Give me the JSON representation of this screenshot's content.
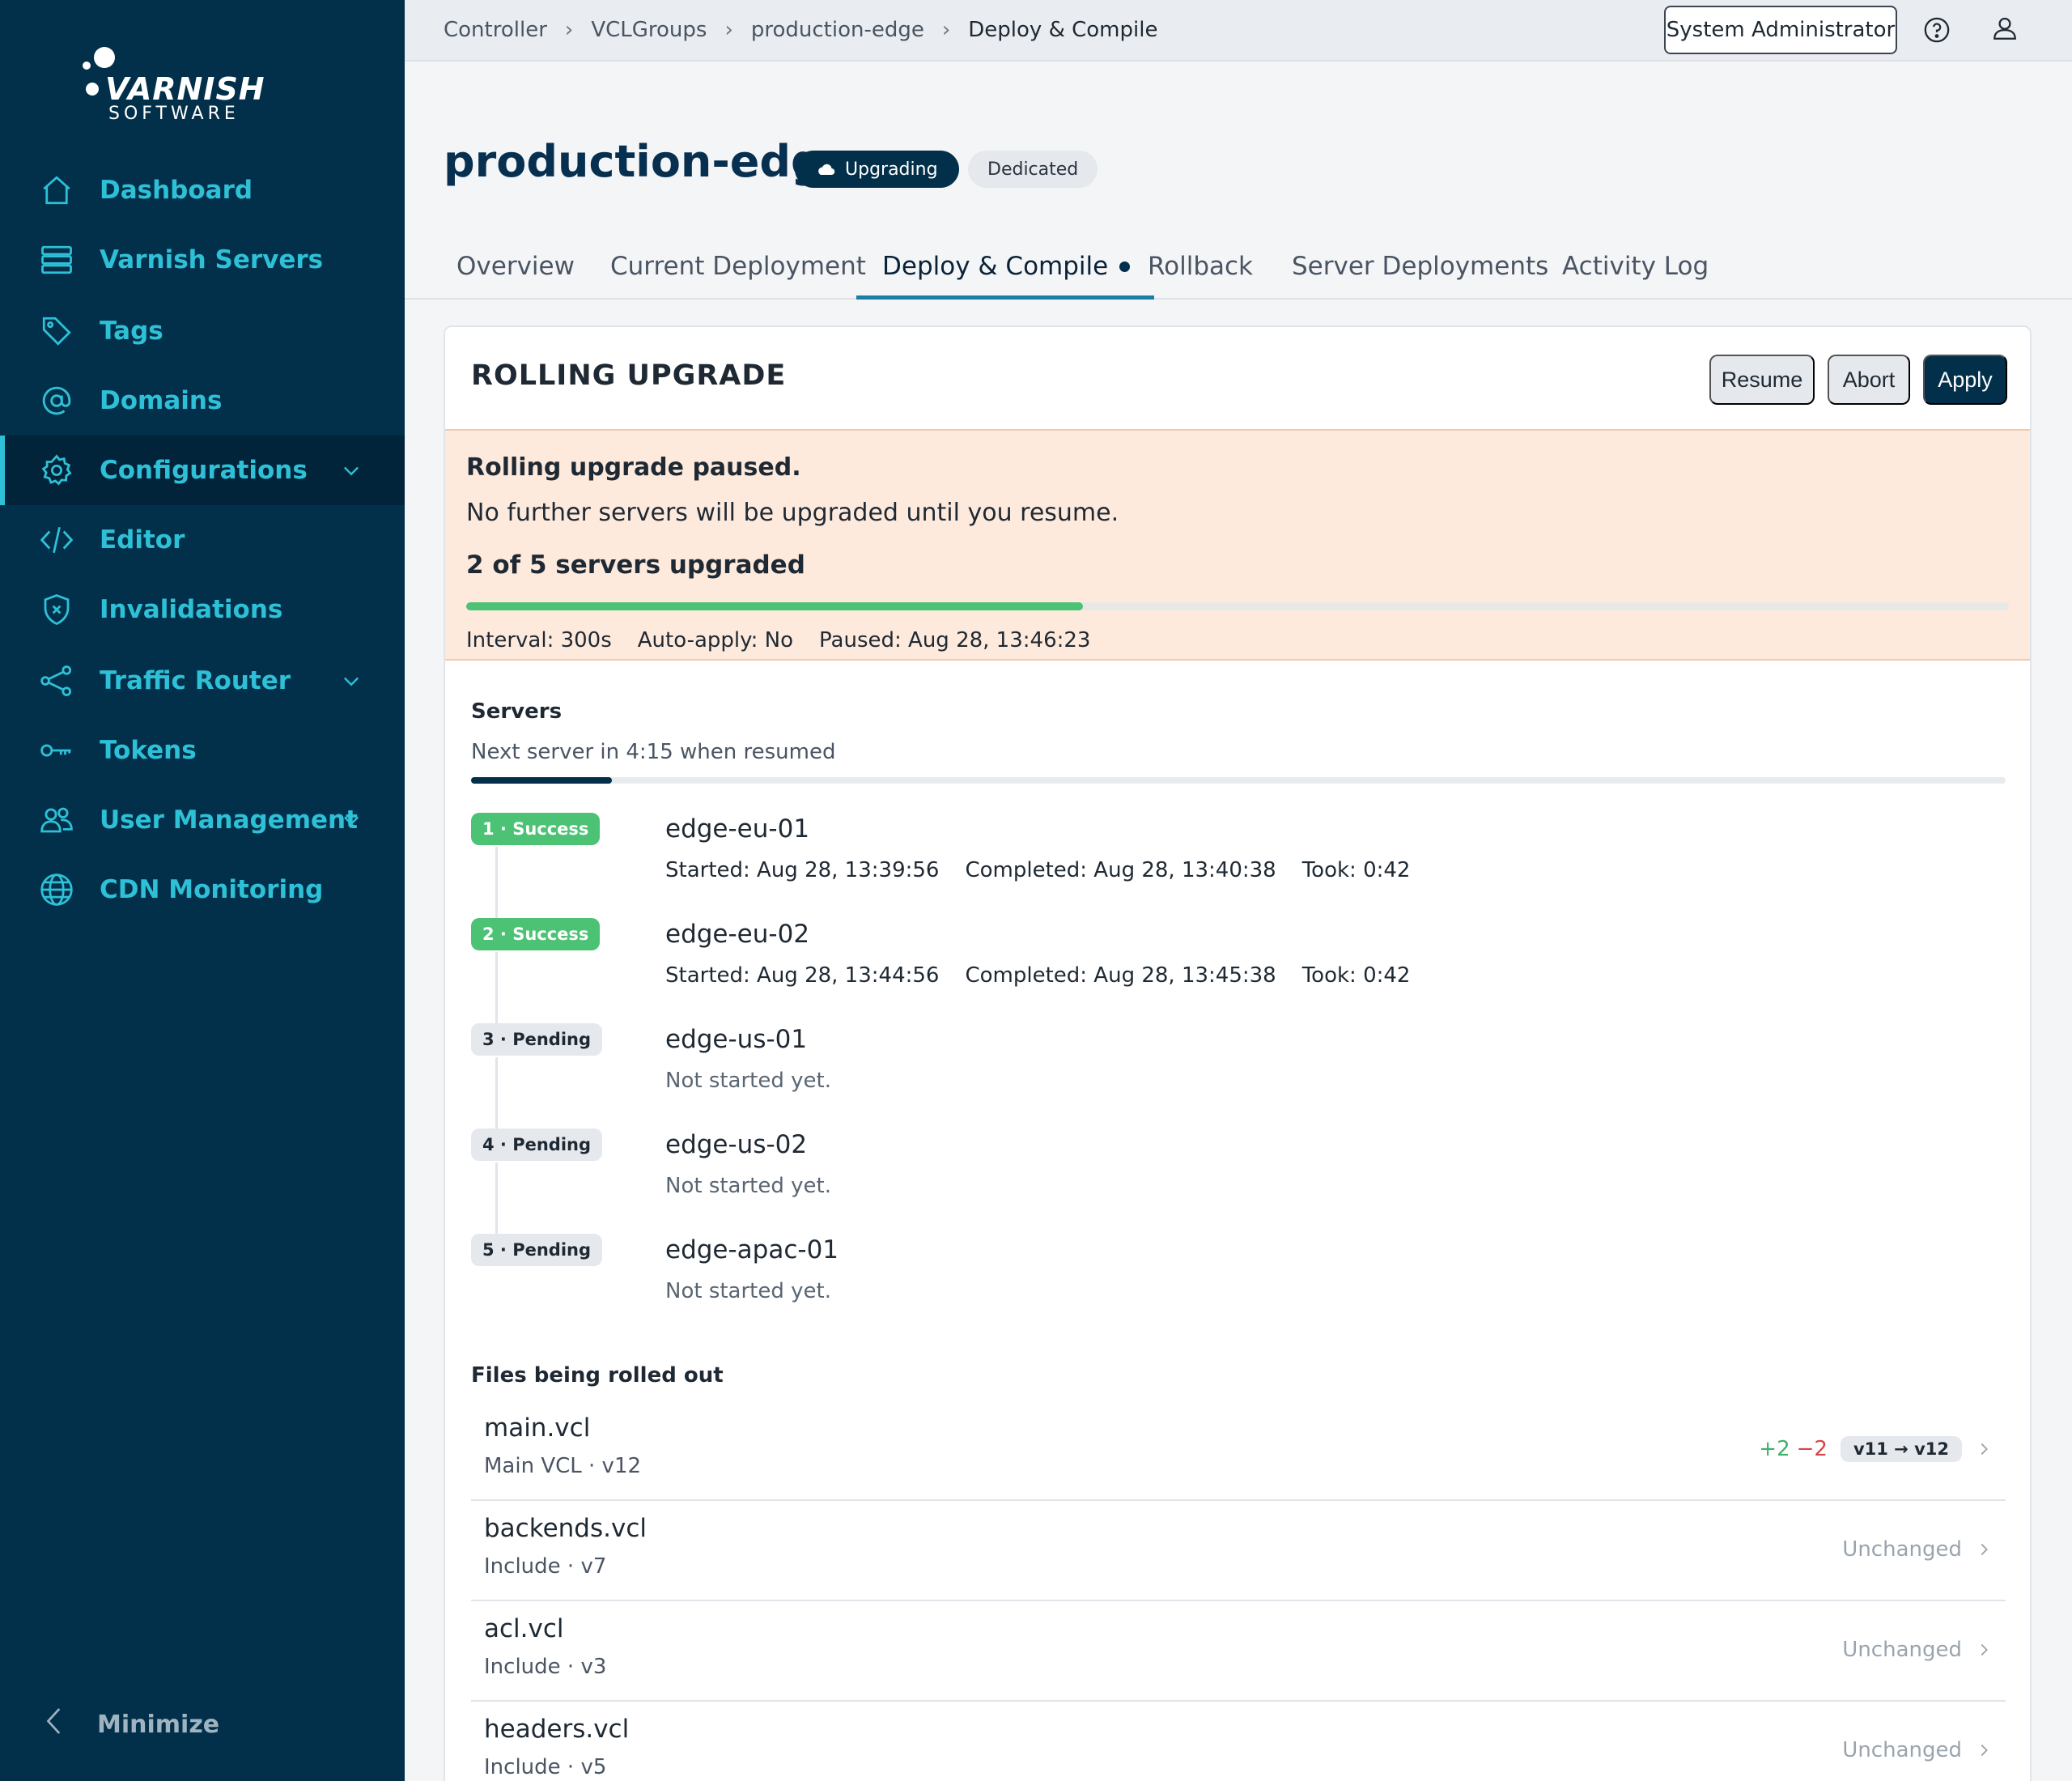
{
  "brand": {
    "name": "VARNISH",
    "sub": "SOFTWARE"
  },
  "sidebar": {
    "items": [
      {
        "label": "Dashboard",
        "icon": "home-icon"
      },
      {
        "label": "Varnish Servers",
        "icon": "servers-icon"
      },
      {
        "label": "Tags",
        "icon": "tag-icon"
      },
      {
        "label": "Domains",
        "icon": "at-icon"
      },
      {
        "label": "Configurations",
        "icon": "gear-icon",
        "active": true,
        "expandable": true
      },
      {
        "label": "Editor",
        "icon": "code-icon"
      },
      {
        "label": "Invalidations",
        "icon": "shield-icon"
      },
      {
        "label": "Traffic Router",
        "icon": "share-icon",
        "expandable": true
      },
      {
        "label": "Tokens",
        "icon": "key-icon"
      },
      {
        "label": "User Management",
        "icon": "users-icon",
        "expandable": true
      },
      {
        "label": "CDN Monitoring",
        "icon": "globe-icon"
      }
    ],
    "minimize": "Minimize"
  },
  "topbar": {
    "breadcrumbs": [
      "Controller",
      "VCLGroups",
      "production-edge",
      "Deploy & Compile"
    ],
    "user": "System Administrator"
  },
  "header": {
    "title": "production-edge",
    "status_badge": "Upgrading",
    "type_badge": "Dedicated"
  },
  "tabs": [
    "Overview",
    "Current Deployment",
    "Deploy & Compile",
    "Rollback",
    "Server Deployments",
    "Activity Log"
  ],
  "active_tab": "Deploy & Compile",
  "card": {
    "title": "ROLLING UPGRADE",
    "buttons": {
      "resume": "Resume",
      "abort": "Abort",
      "apply": "Apply"
    }
  },
  "alert": {
    "heading": "Rolling upgrade paused.",
    "message": "No further servers will be upgraded until you resume.",
    "progress_label": "2 of 5 servers upgraded",
    "progress_fraction": 0.4,
    "interval": "Interval: 300s",
    "auto_apply": "Auto-apply: No",
    "paused": "Paused: Aug 28, 13:46:23"
  },
  "servers": {
    "title": "Servers",
    "next": "Next server in 4:15 when resumed",
    "countdown_fraction": 0.092,
    "steps": [
      {
        "pill": "1 · Success",
        "status": "success",
        "name": "edge-eu-01",
        "started": "Started: Aug 28, 13:39:56",
        "completed": "Completed: Aug 28, 13:40:38",
        "took": "Took: 0:42"
      },
      {
        "pill": "2 · Success",
        "status": "success",
        "name": "edge-eu-02",
        "started": "Started: Aug 28, 13:44:56",
        "completed": "Completed: Aug 28, 13:45:38",
        "took": "Took: 0:42"
      },
      {
        "pill": "3 · Pending",
        "status": "pending",
        "name": "edge-us-01",
        "note": "Not started yet."
      },
      {
        "pill": "4 · Pending",
        "status": "pending",
        "name": "edge-us-02",
        "note": "Not started yet."
      },
      {
        "pill": "5 · Pending",
        "status": "pending",
        "name": "edge-apac-01",
        "note": "Not started yet."
      }
    ]
  },
  "files": {
    "title": "Files being rolled out",
    "items": [
      {
        "name": "main.vcl",
        "sub": "Main VCL · v12",
        "added": "+2",
        "removed": "−2",
        "version": "v11 → v12"
      },
      {
        "name": "backends.vcl",
        "sub": "Include · v7",
        "state": "Unchanged"
      },
      {
        "name": "acl.vcl",
        "sub": "Include · v3",
        "state": "Unchanged"
      },
      {
        "name": "headers.vcl",
        "sub": "Include · v5",
        "state": "Unchanged"
      }
    ]
  },
  "colors": {
    "sidebar": "#02304a",
    "accent": "#2ec0d6",
    "success": "#4cc274",
    "alert_bg": "#fdeadd"
  }
}
